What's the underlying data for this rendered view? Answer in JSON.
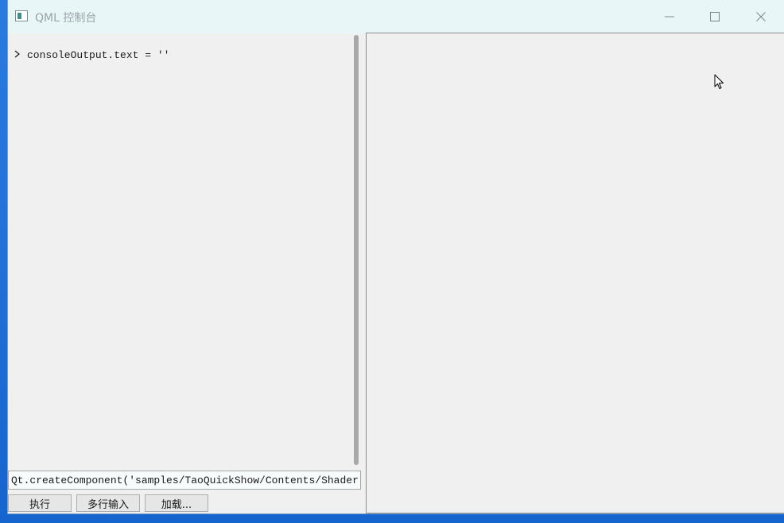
{
  "window": {
    "title": "QML 控制台",
    "icon": "qt-console-app-icon"
  },
  "titlebar_buttons": {
    "minimize": "minimize-icon",
    "maximize": "maximize-icon",
    "close": "close-icon"
  },
  "console": {
    "prompt_icon": "chevron-right-icon",
    "lines": [
      {
        "text": "consoleOutput.text = ''"
      }
    ]
  },
  "command_input": {
    "value": "Qt.createComponent('samples/TaoQuickShow/Contents/ShaderEffect/"
  },
  "buttons": {
    "run": "执行",
    "multiline": "多行输入",
    "load": "加载..."
  },
  "colors": {
    "titlebar_bg": "#e8f6f8",
    "window_bg": "#f0f0f0",
    "desktop": "#1f6fd1"
  }
}
